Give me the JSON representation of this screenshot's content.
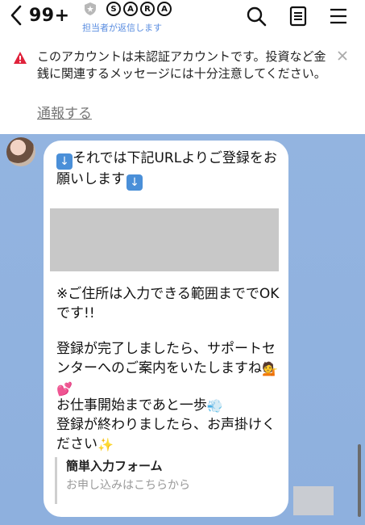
{
  "header": {
    "unread_count": "99+",
    "account_name": [
      "S",
      "A",
      "R",
      "A"
    ],
    "subtitle": "担当者が返信します",
    "icons": [
      "back-chevron-icon",
      "shield-icon",
      "search-icon",
      "notes-icon",
      "menu-icon"
    ]
  },
  "warning": {
    "message": "このアカウントは未認証アカウントです。投資など金銭に関連するメッセージには十分注意してください。",
    "report_link": "通報する",
    "accent_color": "#e0223b"
  },
  "message": {
    "line1": "それでは下記URLよりご登録をお願いします",
    "line2": "※ご住所は入力できる範囲まででOKです!!",
    "line3": "登録が完了しましたら、サポートセンターへのご案内をいたしますね",
    "line4": "お仕事開始まであと一歩",
    "line5": "登録が終わりましたら、お声掛けください",
    "link_title": "簡単入力フォーム",
    "link_subtitle": "お申し込みはこちらから"
  },
  "colors": {
    "chat_background": "#8fb1df",
    "subtitle_blue": "#5a8de0"
  }
}
